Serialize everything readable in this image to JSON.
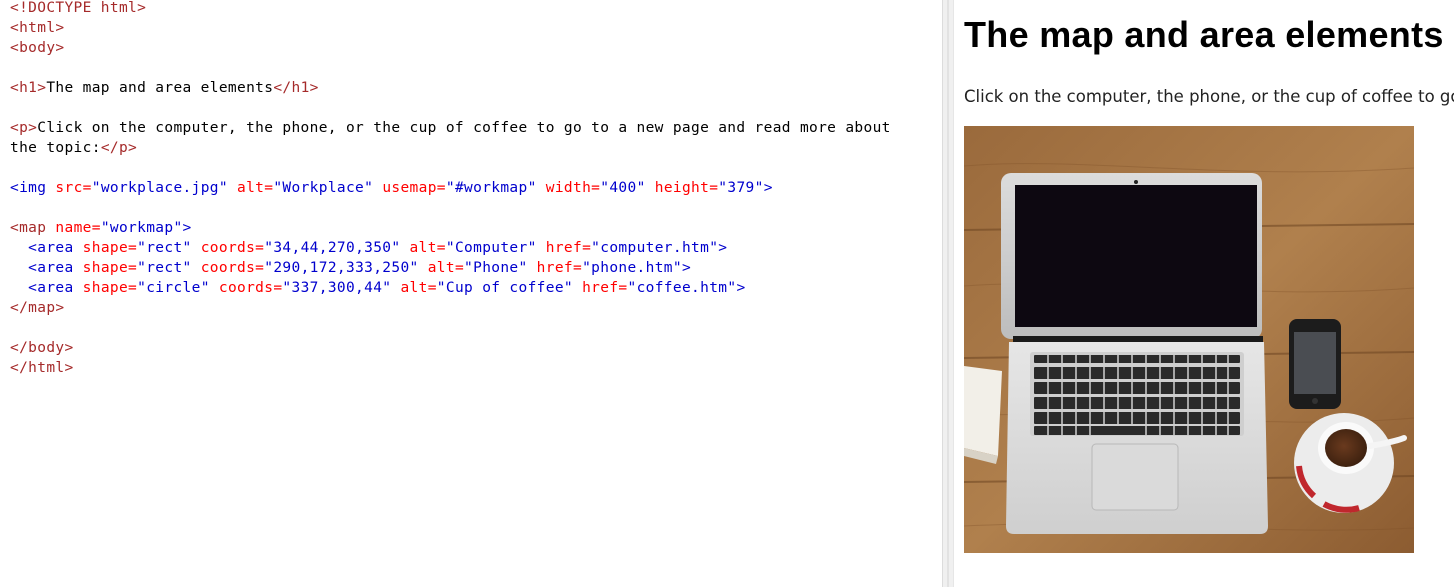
{
  "editor": {
    "lines": [
      [
        {
          "c": "t-doctype",
          "t": "<!DOCTYPE html>"
        }
      ],
      [
        {
          "c": "t-tag",
          "t": "<html>"
        }
      ],
      [
        {
          "c": "t-tag",
          "t": "<body>"
        }
      ],
      [],
      [
        {
          "c": "t-tag",
          "t": "<h1>"
        },
        {
          "c": "t-text",
          "t": "The map and area elements"
        },
        {
          "c": "t-tag",
          "t": "</h1>"
        }
      ],
      [],
      [
        {
          "c": "t-tag",
          "t": "<p>"
        },
        {
          "c": "t-text",
          "t": "Click on the computer, the phone, or the cup of coffee to go to a new page and read more about"
        }
      ],
      [
        {
          "c": "t-text",
          "t": "the topic:"
        },
        {
          "c": "t-tag",
          "t": "</p>"
        }
      ],
      [],
      [
        {
          "c": "t-el",
          "t": "<img "
        },
        {
          "c": "t-attr",
          "t": "src="
        },
        {
          "c": "t-val",
          "t": "\"workplace.jpg\" "
        },
        {
          "c": "t-attr",
          "t": "alt="
        },
        {
          "c": "t-val",
          "t": "\"Workplace\" "
        },
        {
          "c": "t-attr",
          "t": "usemap="
        },
        {
          "c": "t-val",
          "t": "\"#workmap\" "
        },
        {
          "c": "t-attr",
          "t": "width="
        },
        {
          "c": "t-val",
          "t": "\"400\" "
        },
        {
          "c": "t-attr",
          "t": "height="
        },
        {
          "c": "t-val",
          "t": "\"379\""
        },
        {
          "c": "t-el",
          "t": ">"
        }
      ],
      [],
      [
        {
          "c": "t-tag",
          "t": "<map "
        },
        {
          "c": "t-attr",
          "t": "name="
        },
        {
          "c": "t-val",
          "t": "\"workmap\""
        },
        {
          "c": "t-el",
          "t": ">"
        }
      ],
      [
        {
          "c": "t-text",
          "t": "  "
        },
        {
          "c": "t-el",
          "t": "<area "
        },
        {
          "c": "t-attr",
          "t": "shape="
        },
        {
          "c": "t-val",
          "t": "\"rect\" "
        },
        {
          "c": "t-attr",
          "t": "coords="
        },
        {
          "c": "t-val",
          "t": "\"34,44,270,350\" "
        },
        {
          "c": "t-attr",
          "t": "alt="
        },
        {
          "c": "t-val",
          "t": "\"Computer\" "
        },
        {
          "c": "t-attr",
          "t": "href="
        },
        {
          "c": "t-val",
          "t": "\"computer.htm\""
        },
        {
          "c": "t-el",
          "t": ">"
        }
      ],
      [
        {
          "c": "t-text",
          "t": "  "
        },
        {
          "c": "t-el",
          "t": "<area "
        },
        {
          "c": "t-attr",
          "t": "shape="
        },
        {
          "c": "t-val",
          "t": "\"rect\" "
        },
        {
          "c": "t-attr",
          "t": "coords="
        },
        {
          "c": "t-val",
          "t": "\"290,172,333,250\" "
        },
        {
          "c": "t-attr",
          "t": "alt="
        },
        {
          "c": "t-val",
          "t": "\"Phone\" "
        },
        {
          "c": "t-attr",
          "t": "href="
        },
        {
          "c": "t-val",
          "t": "\"phone.htm\""
        },
        {
          "c": "t-el",
          "t": ">"
        }
      ],
      [
        {
          "c": "t-text",
          "t": "  "
        },
        {
          "c": "t-el",
          "t": "<area "
        },
        {
          "c": "t-attr",
          "t": "shape="
        },
        {
          "c": "t-val",
          "t": "\"circle\" "
        },
        {
          "c": "t-attr",
          "t": "coords="
        },
        {
          "c": "t-val",
          "t": "\"337,300,44\" "
        },
        {
          "c": "t-attr",
          "t": "alt="
        },
        {
          "c": "t-val",
          "t": "\"Cup of coffee\" "
        },
        {
          "c": "t-attr",
          "t": "href="
        },
        {
          "c": "t-val",
          "t": "\"coffee.htm\""
        },
        {
          "c": "t-el",
          "t": ">"
        }
      ],
      [
        {
          "c": "t-tag",
          "t": "</map>"
        }
      ],
      [],
      [
        {
          "c": "t-tag",
          "t": "</body>"
        }
      ],
      [
        {
          "c": "t-tag",
          "t": "</html>"
        }
      ]
    ]
  },
  "preview": {
    "heading": "The map and area elements",
    "paragraph": "Click on the computer, the phone, or the cup of coffee to go to a new page and read more about the topic:"
  },
  "colors": {
    "tag": "#a52a2a",
    "attribute": "#ff0000",
    "value": "#0000cd",
    "text": "#000000"
  },
  "icons": [
    "workplace-image"
  ]
}
